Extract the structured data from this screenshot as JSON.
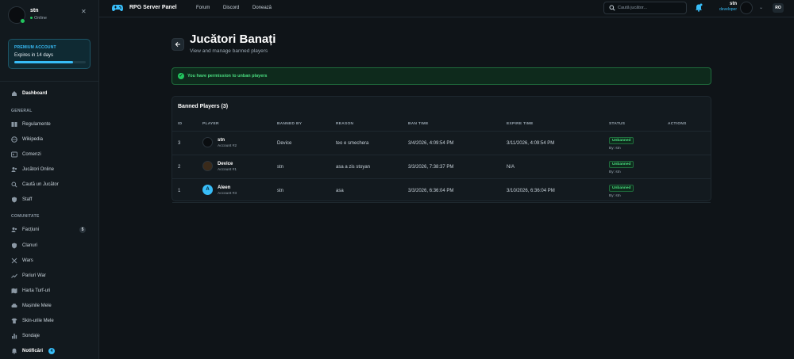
{
  "sidebar": {
    "user": {
      "name": "stn",
      "status": "Online"
    },
    "premium": {
      "label": "PREMIUM ACCOUNT",
      "expires": "Expires in 14 days",
      "progress": 0.82
    },
    "dashboard": "Dashboard",
    "general_heading": "GENERAL",
    "general_items": [
      "Regulamente",
      "Wikipedia",
      "Comenzi",
      "Jucători Online",
      "Caută un Jucător",
      "Staff"
    ],
    "community_heading": "COMUNITATE",
    "community_items": [
      "Facțiuni",
      "Clanuri",
      "Wars",
      "Pariuri War",
      "Harta Turf-uri",
      "Mașinile Mele",
      "Skin-urile Mele",
      "Sondaje"
    ],
    "factions_badge": "5",
    "notifications": {
      "label": "Notificări",
      "count": "4"
    }
  },
  "topbar": {
    "brand": "RPG Server Panel",
    "links": [
      "Forum",
      "Discord",
      "Donează"
    ],
    "search_placeholder": "Caută jucător...",
    "user_name": "stn",
    "user_role": "developer",
    "lang": "RO"
  },
  "page": {
    "title": "Jucători Banați",
    "subtitle": "View and manage banned players",
    "alert": "You have permission to unban players"
  },
  "table": {
    "title": "Banned Players (3)",
    "columns": [
      "ID",
      "PLAYER",
      "BANNED BY",
      "REASON",
      "BAN TIME",
      "EXPIRE TIME",
      "STATUS",
      "ACTIONS"
    ],
    "rows": [
      {
        "id": "3",
        "name": "stn",
        "account": "Account #2",
        "banned_by": "Device",
        "reason": "teo e smechera",
        "ban_time": "3/4/2026, 4:09:54 PM",
        "expire_time": "3/11/2026, 4:09:54 PM",
        "status": "Unbanned",
        "by": "By: stn",
        "avatar_color": "#0a0d10"
      },
      {
        "id": "2",
        "name": "Device",
        "account": "Account #1",
        "banned_by": "stn",
        "reason": "asa a zis stoyan",
        "ban_time": "3/3/2026, 7:38:37 PM",
        "expire_time": "N/A",
        "status": "Unbanned",
        "by": "By: stn",
        "avatar_color": "#3a2a1a"
      },
      {
        "id": "1",
        "name": "Aleen",
        "account": "Account #3",
        "banned_by": "stn",
        "reason": "asa",
        "ban_time": "3/3/2026, 6:36:04 PM",
        "expire_time": "3/10/2026, 6:36:04 PM",
        "status": "Unbanned",
        "by": "By: stn",
        "avatar_color": "#38bdf8",
        "avatar_letter": "A"
      }
    ]
  },
  "colors": {
    "accent": "#38bdf8",
    "success": "#22c55e",
    "bg": "#0f1418"
  }
}
